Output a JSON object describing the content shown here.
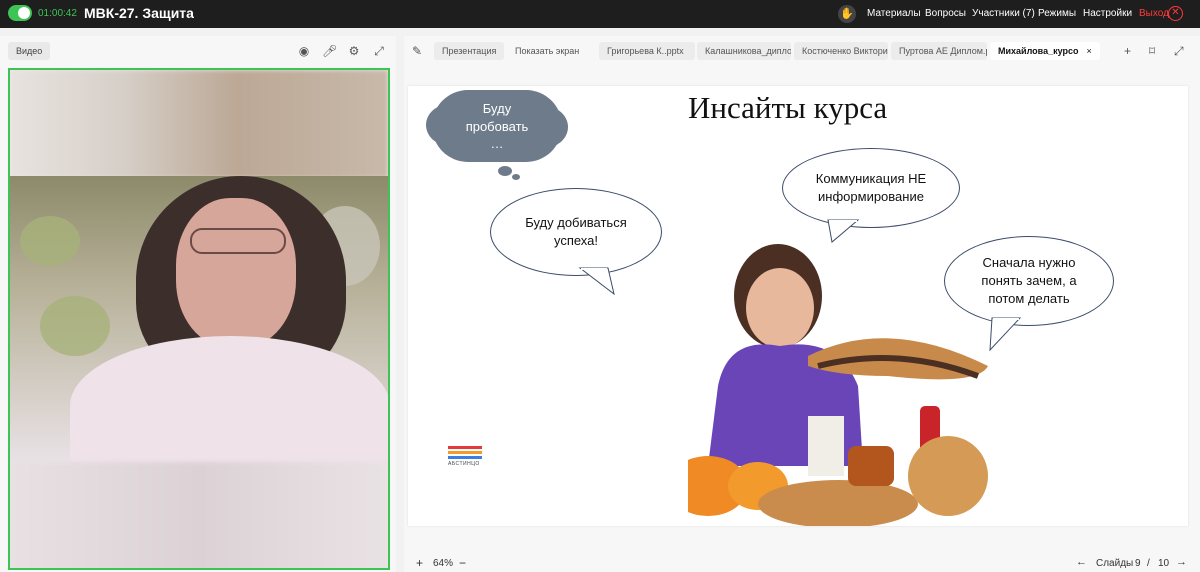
{
  "header": {
    "timer": "01:00:42",
    "title": "МВК-27. Защита",
    "menu": [
      "Материалы",
      "Вопросы",
      "Участники (7)",
      "Режимы",
      "Настройки"
    ],
    "exit_label": "Выход"
  },
  "video_panel": {
    "tab_label": "Видео"
  },
  "presentation": {
    "tabs": [
      "Презентация",
      "Показать экран",
      "Григорьева К..pptx",
      "Калашникова_дипло",
      "Костюченко Виктори",
      "Пуртова АЕ Диплом.р",
      "Михайлова_курсо"
    ],
    "active_tab_close": "×",
    "slide": {
      "title": "Инсайты курса",
      "cloud_text": "Буду\nпробовать\n…",
      "bubble1": "Буду добиваться\nуспеха!",
      "bubble2": "Коммуникация НЕ\nинформирование",
      "bubble3": "Сначала нужно\nпонять зачем, а\nпотом делать",
      "logo_text": "АБСТИНЦО"
    },
    "zoom": "64%",
    "slides_label": "Слайды",
    "slide_current": "9",
    "slide_sep": "/",
    "slide_total": "10"
  },
  "colors": {
    "accent_green": "#3ec455",
    "exit_red": "#ff3b3b"
  }
}
